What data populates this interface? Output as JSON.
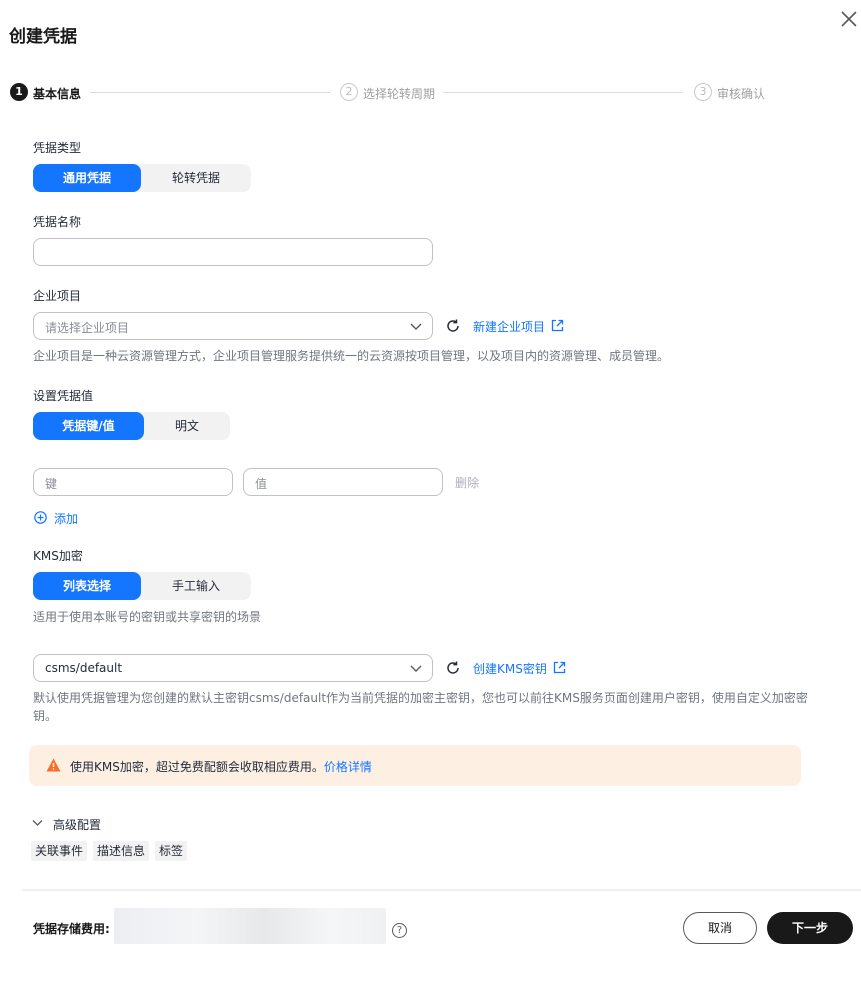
{
  "dialog": {
    "title": "创建凭据"
  },
  "steps": [
    {
      "num": "1",
      "label": "基本信息"
    },
    {
      "num": "2",
      "label": "选择轮转周期"
    },
    {
      "num": "3",
      "label": "审核确认"
    }
  ],
  "secret_type": {
    "label": "凭据类型",
    "options": [
      "通用凭据",
      "轮转凭据"
    ],
    "selected": "通用凭据"
  },
  "secret_name": {
    "label": "凭据名称",
    "value": ""
  },
  "enterprise_project": {
    "label": "企业项目",
    "placeholder": "请选择企业项目",
    "create_link": "新建企业项目",
    "help": "企业项目是一种云资源管理方式，企业项目管理服务提供统一的云资源按项目管理，以及项目内的资源管理、成员管理。"
  },
  "secret_value": {
    "label": "设置凭据值",
    "options": [
      "凭据键/值",
      "明文"
    ],
    "selected": "凭据键/值",
    "key_placeholder": "键",
    "value_placeholder": "值",
    "delete_label": "删除",
    "add_label": "添加"
  },
  "kms": {
    "label": "KMS加密",
    "options": [
      "列表选择",
      "手工输入"
    ],
    "selected": "列表选择",
    "scope_help": "适用于使用本账号的密钥或共享密钥的场景",
    "key_value": "csms/default",
    "create_link": "创建KMS密钥",
    "help_line1": "默认使用凭据管理为您创建的默认主密钥csms/default作为当前凭据的加密主密钥，您也可以前往KMS服务页面创建用户密钥，使用自定义加密密",
    "help_line2": "钥。"
  },
  "warning": {
    "text": "使用KMS加密，超过免费配额会收取相应费用。",
    "link": "价格详情"
  },
  "advanced": {
    "label": "高级配置",
    "tags": [
      "关联事件",
      "描述信息",
      "标签"
    ]
  },
  "footer": {
    "fee_label": "凭据存储费用:",
    "cancel_label": "取消",
    "next_label": "下一步"
  },
  "colors": {
    "primary": "#1476ff",
    "dark_button": "#191919",
    "warning_bg": "#fdf0e2",
    "warning_icon": "#f66f2a"
  }
}
